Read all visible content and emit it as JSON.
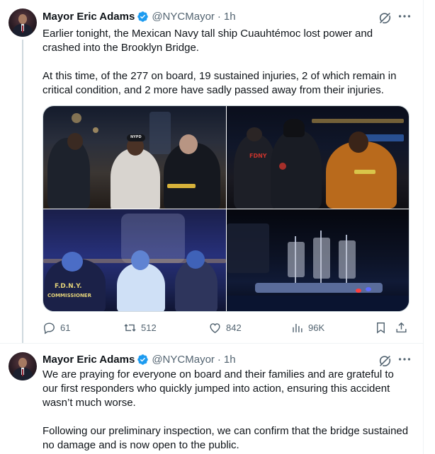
{
  "tweets": [
    {
      "author": {
        "name": "Mayor Eric Adams",
        "handle": "@NYCMayor",
        "verified": true,
        "verified_color": "#1d9bf0"
      },
      "time": "1h",
      "separator": "·",
      "paragraphs": [
        "Earlier tonight, the Mexican Navy tall ship Cuauhtémoc lost power and crashed into the Brooklyn Bridge.",
        "At this time, of the 277 on board, 19 sustained injuries, 2 of which remain in critical condition, and 2 more have sadly passed away from their injuries."
      ],
      "media": [
        {
          "icon": "photo-mayor-with-fdny-officials",
          "caption": "NYPD",
          "colors": [
            "#141b2c",
            "#3b3633"
          ]
        },
        {
          "icon": "photo-firefighters-at-night",
          "caption": "FDNY",
          "colors": [
            "#0a0e1c",
            "#1a1a22"
          ]
        },
        {
          "icon": "photo-fdny-commissioner-viewing-ship",
          "caption_line1": "F.D.N.Y.",
          "caption_line2": "COMMISSIONER",
          "colors": [
            "#1a1f4a",
            "#27307a"
          ]
        },
        {
          "icon": "photo-tall-ship-at-night",
          "caption": "",
          "colors": [
            "#05070e",
            "#101a36"
          ]
        }
      ],
      "actions": {
        "replies": "61",
        "reposts": "512",
        "likes": "842",
        "views": "96K"
      }
    },
    {
      "author": {
        "name": "Mayor Eric Adams",
        "handle": "@NYCMayor",
        "verified": true,
        "verified_color": "#1d9bf0"
      },
      "time": "1h",
      "separator": "·",
      "paragraphs": [
        "We are praying for everyone on board and their families and are grateful to our first responders who quickly jumped into action, ensuring this accident wasn’t much worse.",
        "Following our preliminary inspection, we can confirm that the bridge sustained no damage and is now open to the public."
      ]
    }
  ],
  "icons": {
    "header": [
      "grok-icon",
      "more-icon"
    ],
    "actions": [
      "reply-icon",
      "repost-icon",
      "like-icon",
      "views-icon",
      "bookmark-icon",
      "share-icon"
    ]
  },
  "colors": {
    "text": "#0f1419",
    "secondary": "#536471",
    "border": "#eff3f4",
    "accent": "#1d9bf0"
  }
}
